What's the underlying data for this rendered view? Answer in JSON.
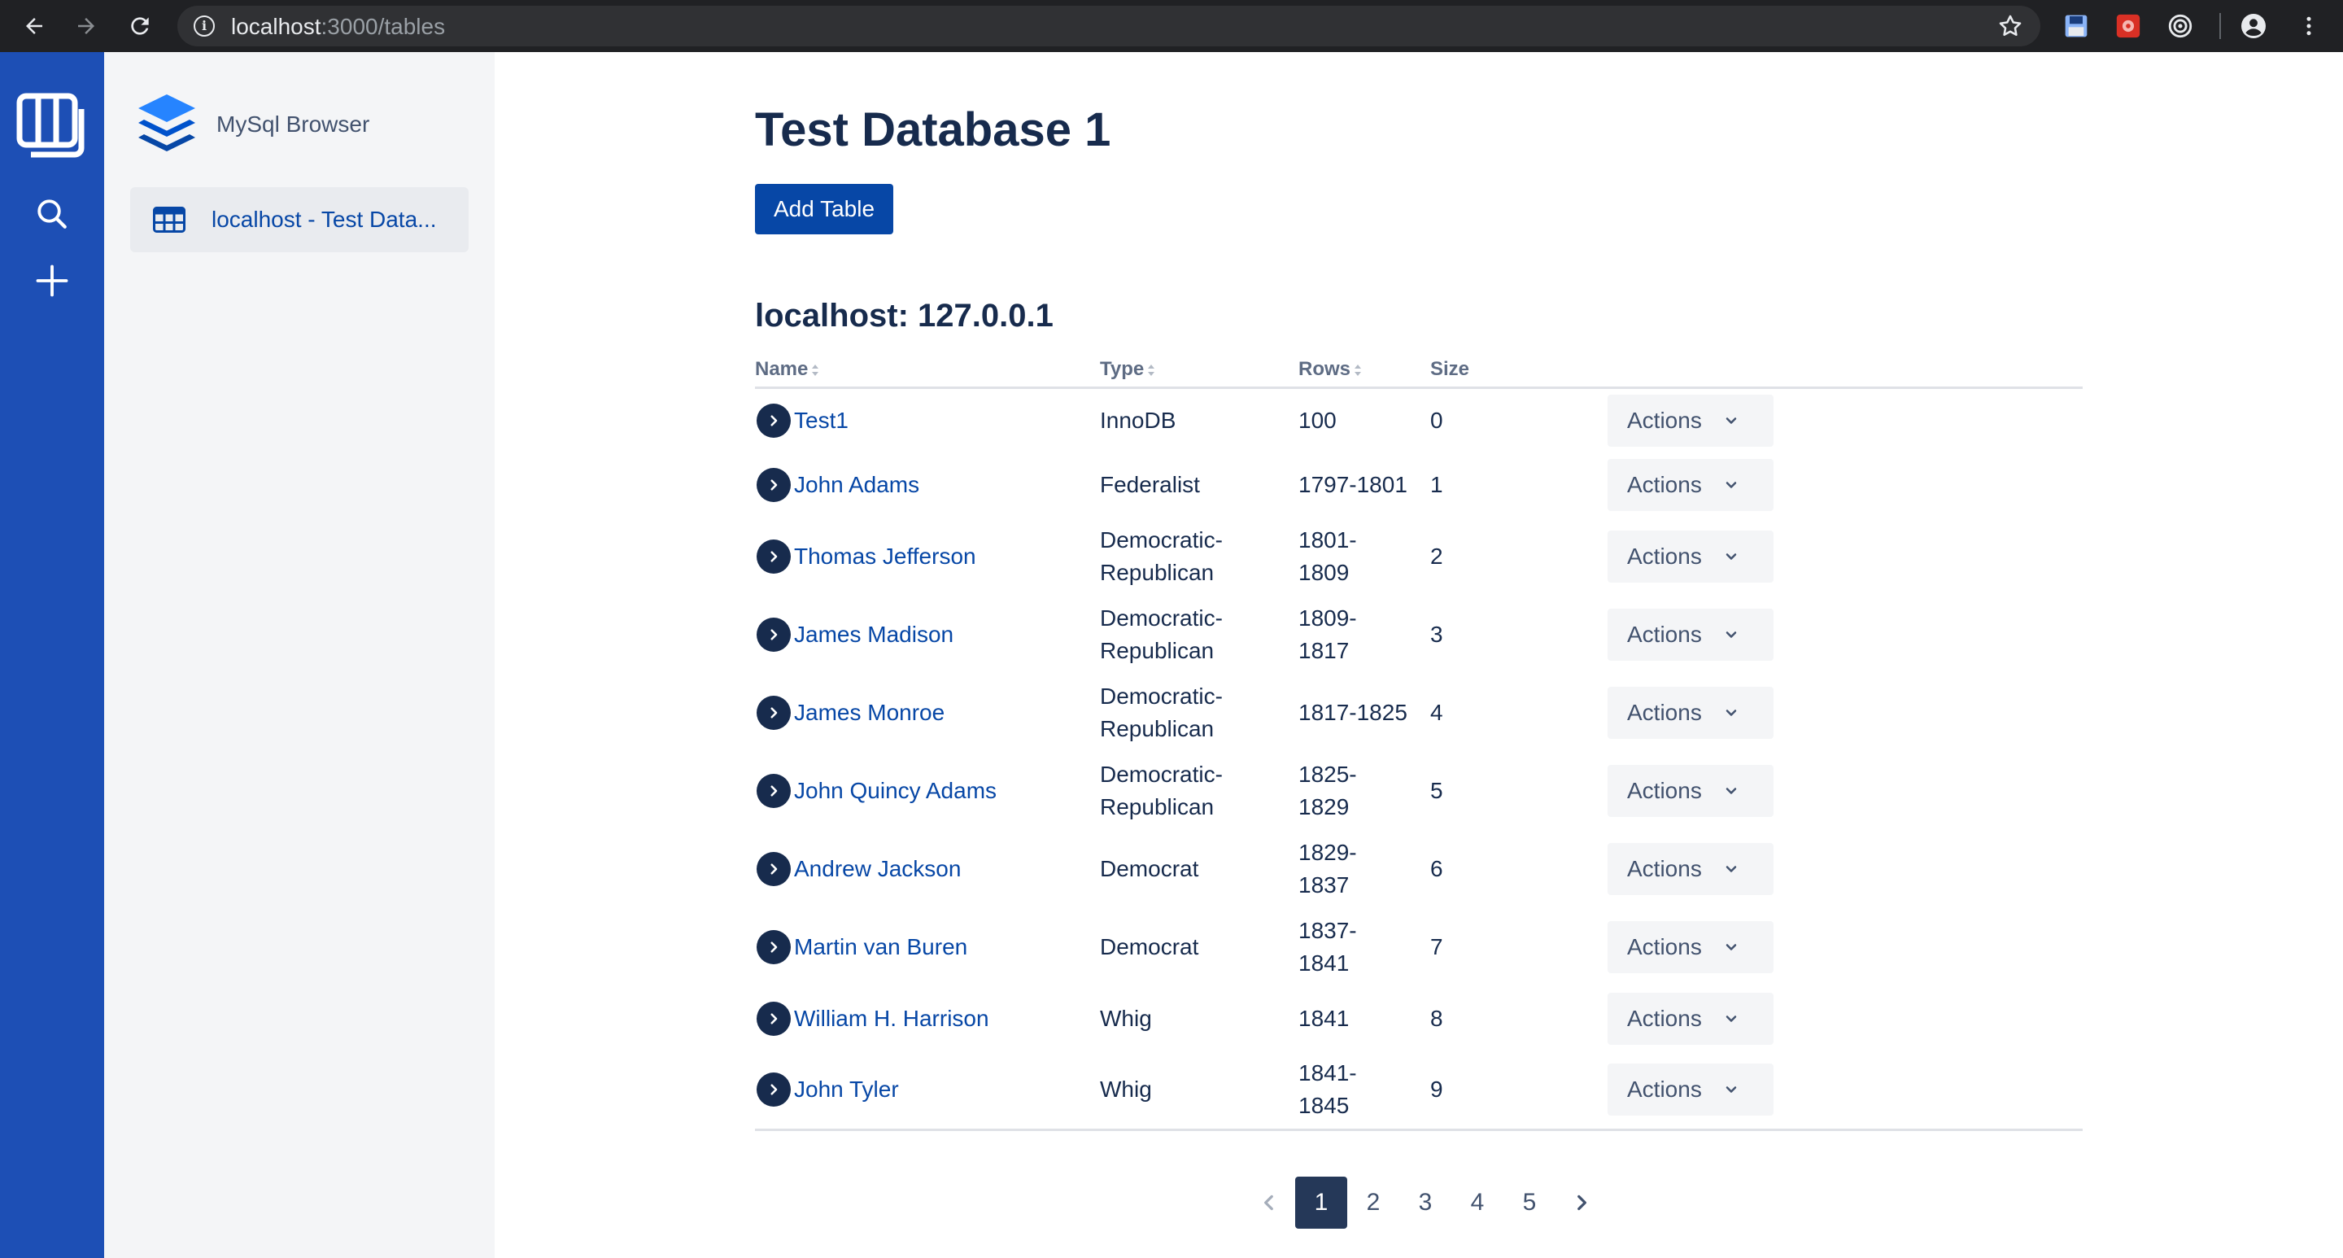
{
  "browser": {
    "url_host": "localhost",
    "url_path": ":3000/tables"
  },
  "sidebar": {
    "brand": "MySql Browser",
    "items": [
      {
        "label": "localhost - Test Data..."
      }
    ]
  },
  "main": {
    "title": "Test Database 1",
    "add_table_label": "Add Table",
    "connection_title": "localhost: 127.0.0.1",
    "columns": {
      "name": "Name",
      "type": "Type",
      "rows": "Rows",
      "size": "Size"
    },
    "actions_label": "Actions",
    "rows": [
      {
        "name": "Test1",
        "type_1": "InnoDB",
        "type_2": "",
        "rows_1": "100",
        "rows_2": "",
        "size": "0"
      },
      {
        "name": "John Adams",
        "type_1": "Federalist",
        "type_2": "",
        "rows_1": "1797-1801",
        "rows_2": "",
        "size": "1"
      },
      {
        "name": "Thomas Jefferson",
        "type_1": "Democratic-",
        "type_2": "Republican",
        "rows_1": "1801-",
        "rows_2": "1809",
        "size": "2"
      },
      {
        "name": "James Madison",
        "type_1": "Democratic-",
        "type_2": "Republican",
        "rows_1": "1809-",
        "rows_2": "1817",
        "size": "3"
      },
      {
        "name": "James Monroe",
        "type_1": "Democratic-",
        "type_2": "Republican",
        "rows_1": "1817-1825",
        "rows_2": "",
        "size": "4"
      },
      {
        "name": "John Quincy Adams",
        "type_1": "Democratic-",
        "type_2": "Republican",
        "rows_1": "1825-",
        "rows_2": "1829",
        "size": "5"
      },
      {
        "name": "Andrew Jackson",
        "type_1": "Democrat",
        "type_2": "",
        "rows_1": "1829-",
        "rows_2": "1837",
        "size": "6"
      },
      {
        "name": "Martin van Buren",
        "type_1": "Democrat",
        "type_2": "",
        "rows_1": "1837-",
        "rows_2": "1841",
        "size": "7"
      },
      {
        "name": "William H. Harrison",
        "type_1": "Whig",
        "type_2": "",
        "rows_1": "1841",
        "rows_2": "",
        "size": "8"
      },
      {
        "name": "John Tyler",
        "type_1": "Whig",
        "type_2": "",
        "rows_1": "1841-",
        "rows_2": "1845",
        "size": "9"
      }
    ],
    "pagination": {
      "pages": [
        "1",
        "2",
        "3",
        "4",
        "5"
      ],
      "current": "1"
    }
  },
  "colors": {
    "rail": "#1d4fb5",
    "primary": "#0747a6",
    "sidebar_bg": "#f4f5f7",
    "text": "#172b4d"
  }
}
